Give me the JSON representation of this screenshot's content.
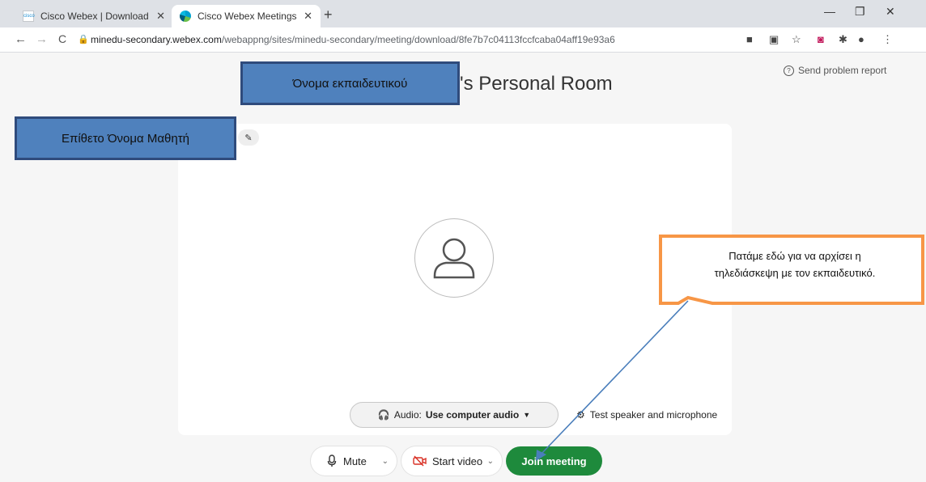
{
  "browser": {
    "tabs": [
      {
        "label": "Cisco Webex | Download",
        "favicon": "cisco-favicon"
      },
      {
        "label": "Cisco Webex Meetings Web App",
        "favicon": "webex-favicon"
      }
    ],
    "address": {
      "host": "minedu-secondary.webex.com",
      "path": "/webappng/sites/minedu-secondary/meeting/download/8fe7b7c04113fccfcaba04aff19e93a6"
    }
  },
  "page": {
    "room_title": "'s Personal Room",
    "send_problem_report": "Send problem report",
    "audio_prefix": "Audio:",
    "audio_value": "Use computer audio",
    "test_speaker": "Test speaker and microphone",
    "mute_label": "Mute",
    "start_video_label": "Start video",
    "join_label": "Join meeting"
  },
  "annotations": {
    "teacher_name": "Όνομα εκπαιδευτικού",
    "student_name": "Επίθετο Όνομα Μαθητή",
    "callout_line1": "Πατάμε εδώ για να  αρχίσει η",
    "callout_line2": "τηλεδιάσκεψη με τον εκπαιδευτικό."
  },
  "colors": {
    "join_green": "#1e8a3c",
    "annotation_blue": "#4f81bd",
    "callout_orange": "#f79646",
    "arrow_blue": "#4a7ebb"
  }
}
